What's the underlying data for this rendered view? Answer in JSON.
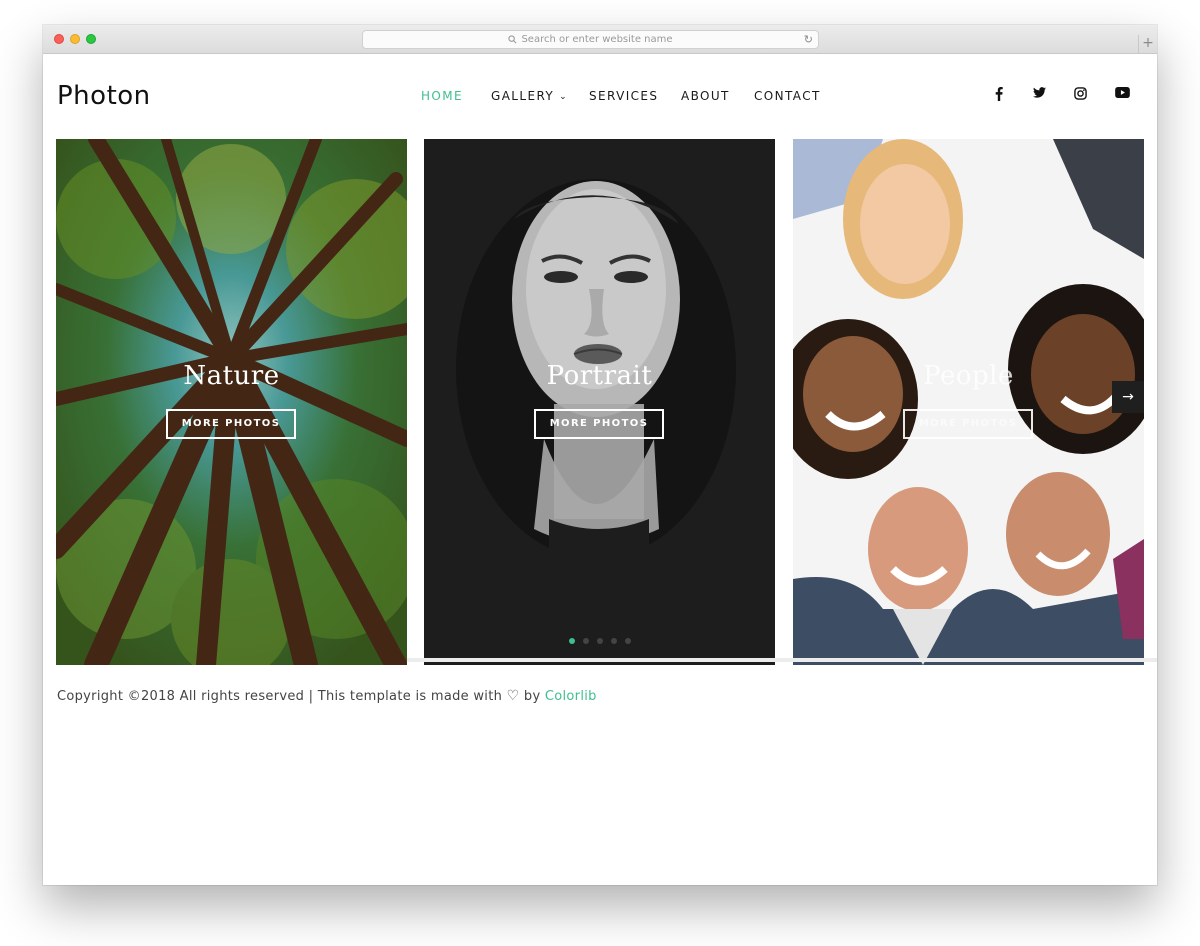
{
  "browser": {
    "url_placeholder": "Search or enter website name",
    "icons": [
      "search-icon",
      "reload-icon",
      "new-tab-icon"
    ]
  },
  "site": {
    "logo": "Photon",
    "accent_color": "#3fbf8e"
  },
  "nav": {
    "items": [
      {
        "label": "HOME",
        "active": true
      },
      {
        "label": "GALLERY",
        "active": false,
        "has_dropdown": true
      },
      {
        "label": "SERVICES",
        "active": false
      },
      {
        "label": "ABOUT",
        "active": false
      },
      {
        "label": "CONTACT",
        "active": false
      }
    ],
    "social_icons": [
      "facebook-icon",
      "twitter-icon",
      "instagram-icon",
      "youtube-icon"
    ]
  },
  "gallery": {
    "panels": [
      {
        "title": "Nature",
        "button": "MORE PHOTOS"
      },
      {
        "title": "Portrait",
        "button": "MORE PHOTOS"
      },
      {
        "title": "People",
        "button": "MORE PHOTOS"
      }
    ],
    "slider": {
      "dot_count": 5,
      "active_index": 0
    }
  },
  "footer": {
    "text_before": "Copyright ©2018 All rights reserved | This template is made with",
    "text_mid": "by",
    "link_text": "Colorlib"
  }
}
